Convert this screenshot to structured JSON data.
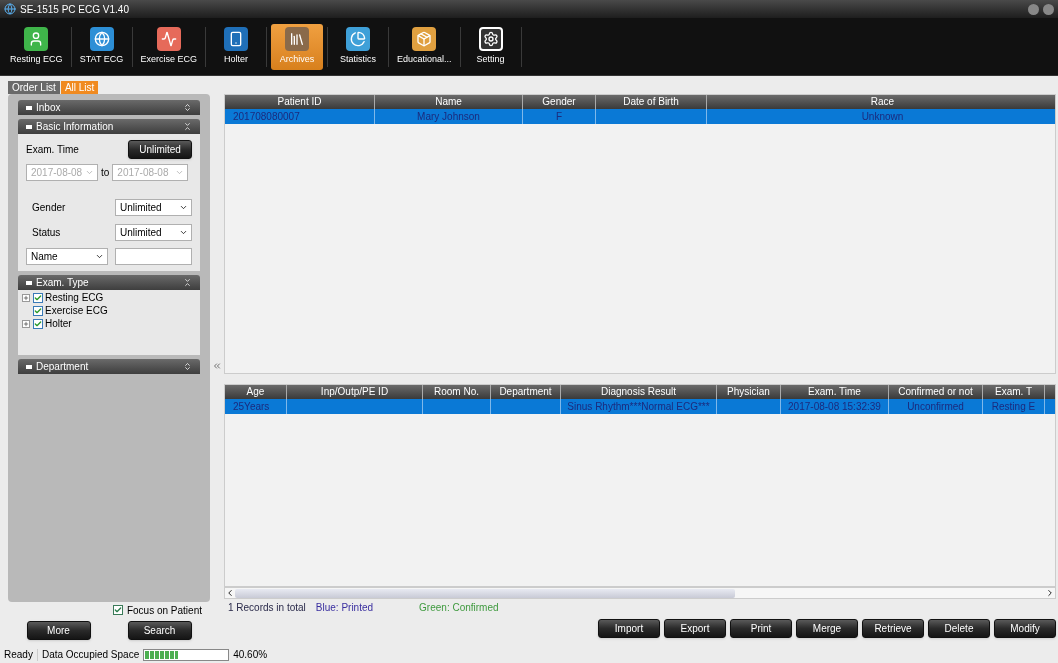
{
  "window": {
    "title": "SE-1515 PC ECG V1.40"
  },
  "toolbar": [
    {
      "label": "Resting ECG",
      "kind": "resting",
      "selected": false
    },
    {
      "label": "STAT ECG",
      "kind": "stat",
      "selected": false
    },
    {
      "label": "Exercise ECG",
      "kind": "exercise",
      "selected": false
    },
    {
      "label": "Holter",
      "kind": "holter",
      "selected": false
    },
    {
      "label": "Archives",
      "kind": "archives",
      "selected": true
    },
    {
      "label": "Statistics",
      "kind": "statistics",
      "selected": false
    },
    {
      "label": "Educational...",
      "kind": "educational",
      "selected": false
    },
    {
      "label": "Setting",
      "kind": "setting",
      "selected": false
    }
  ],
  "list_tabs": [
    {
      "label": "Order List",
      "selected": false
    },
    {
      "label": "All List",
      "selected": true
    }
  ],
  "sidebar": {
    "inbox": {
      "title": "Inbox",
      "expanded": false
    },
    "basic_information": {
      "title": "Basic Information",
      "expanded": true,
      "exam_time_label": "Exam. Time",
      "exam_time_button": "Unlimited",
      "date_from": "2017-08-08",
      "to_label": "to",
      "date_to": "2017-08-08",
      "gender_label": "Gender",
      "gender_value": "Unlimited",
      "status_label": "Status",
      "status_value": "Unlimited",
      "search_by": "Name"
    },
    "exam_type": {
      "title": "Exam. Type",
      "expanded": true,
      "items": [
        {
          "label": "Resting ECG",
          "checked": true,
          "expandable": true
        },
        {
          "label": "Exercise ECG",
          "checked": true,
          "expandable": false
        },
        {
          "label": "Holter",
          "checked": true,
          "expandable": true
        }
      ]
    },
    "department": {
      "title": "Department",
      "expanded": false
    },
    "focus_on_patient": {
      "label": "Focus on Patient",
      "checked": true
    },
    "buttons": [
      "More",
      "Search"
    ]
  },
  "patients_table": {
    "columns": [
      "Patient ID",
      "Name",
      "Gender",
      "Date of Birth",
      "Race"
    ],
    "rows": [
      {
        "selected": true,
        "cells": [
          "201708080007",
          "Mary Johnson",
          "F",
          "",
          "Unknown"
        ]
      }
    ]
  },
  "exams_table": {
    "columns": [
      "Age",
      "Inp/Outp/PE ID",
      "Room No.",
      "Department",
      "Diagnosis Result",
      "Physician",
      "Exam. Time",
      "Confirmed or not",
      "Exam. T"
    ],
    "rows": [
      {
        "selected": true,
        "cells": [
          "25Years",
          "",
          "",
          "",
          "Sinus Rhythm***Normal ECG***",
          "",
          "2017-08-08 15:32:39",
          "Unconfirmed",
          "Resting E"
        ]
      }
    ]
  },
  "records_total": "1 Records in total",
  "legend": [
    {
      "label": "Blue: Printed",
      "color": "#3a2fa0"
    },
    {
      "label": "Green: Confirmed",
      "color": "#3f9a3f"
    }
  ],
  "actions": [
    "Import",
    "Export",
    "Print",
    "Merge",
    "Retrieve",
    "Delete",
    "Modify"
  ],
  "status_bar": {
    "ready": "Ready",
    "storage_label": "Data Occupied Space",
    "storage": {
      "level": 0.406
    },
    "storage_reading": "40.60%"
  }
}
